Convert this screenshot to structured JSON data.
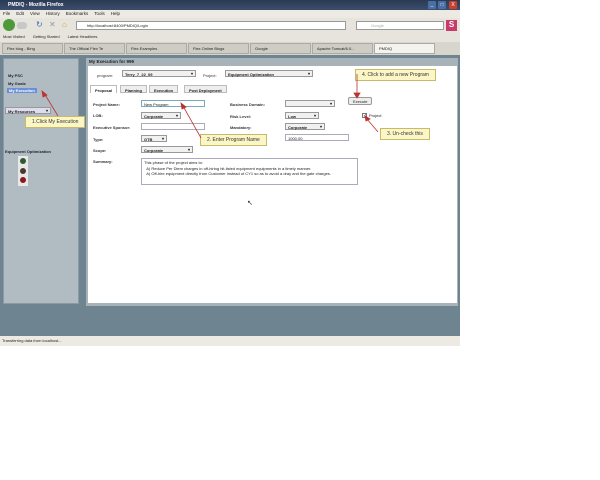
{
  "window": {
    "title": "PMDIQ - Mozilla Firefox",
    "min": "_",
    "max": "□",
    "close": "X"
  },
  "menu": [
    "File",
    "Edit",
    "View",
    "History",
    "Bookmarks",
    "Tools",
    "Help"
  ],
  "nav": {
    "url": "http://localhost:8400/PMDIQ/Login",
    "search_placeholder": "Google"
  },
  "bookmarks": [
    "Most Visited",
    "Getting Started",
    "Latest Headlines"
  ],
  "tabs": [
    "Flex blog - Bing",
    "The Official Flex Te",
    "Flex Examples",
    "Flex Online Blogs",
    "Google",
    "Apache Tomcat/6.0...",
    "PMDIQ"
  ],
  "sidebar": {
    "links": [
      "My PSC",
      "My Goals",
      "My Execution"
    ],
    "resources": "My Resources",
    "section": "Equipment Optimization"
  },
  "main": {
    "header": "My Execution for 999",
    "program_label": "program:",
    "program_value": "Terry_7_22_09",
    "project_label": "Project:",
    "project_value": "Equipment Optimization",
    "tabs": [
      "Proposal",
      "Planning",
      "Execution",
      "Post Deployment"
    ],
    "execute": "Execute",
    "project_checkbox": "Project",
    "project_checked": true,
    "fields": {
      "project_name_label": "Project Name:",
      "project_name": "New Program",
      "lob_label": "LOB:",
      "lob": "Corporate",
      "sponsor_label": "Executive Sponsor:",
      "type_label": "Type:",
      "type": "GTB",
      "scope_label": "Scope:",
      "scope": "Corporate",
      "summary_label": "Summary:",
      "summary": "This phase of the project aims to:\n  A) Reduce Per Diem charges in off-hiring hit-listed equipment equipments in a timely manner.\n  A) Off-hire equipment directly from Customer instead of CY1 so as to avoid a dray and the gate charges.",
      "domain_label": "Business Domain:",
      "risk_label": "Risk Level:",
      "risk": "Low",
      "mandatory_label": "Mandatory:",
      "mandatory": "Corporate",
      "amount": "1000.00"
    }
  },
  "callouts": [
    "1.Click My Execution",
    "2. Enter Program Name",
    "3. Un-check this",
    "4. Click to add a new Program"
  ],
  "status": "Transferring data from localhost..."
}
